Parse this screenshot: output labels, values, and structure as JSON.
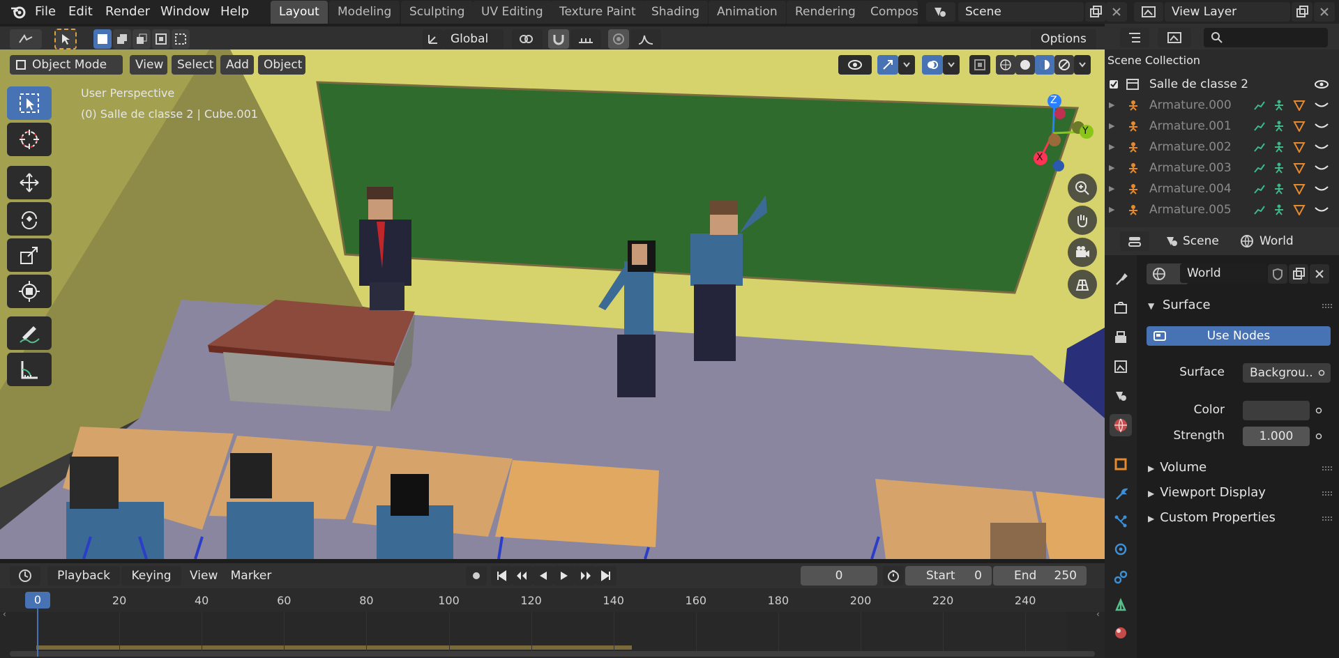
{
  "topbar": {
    "menus": [
      "File",
      "Edit",
      "Render",
      "Window",
      "Help"
    ],
    "workspaces": [
      "Layout",
      "Modeling",
      "Sculpting",
      "UV Editing",
      "Texture Paint",
      "Shading",
      "Animation",
      "Rendering",
      "Compos"
    ],
    "scene_name": "Scene",
    "view_layer": "View Layer"
  },
  "viewport_header": {
    "orientation": "Global",
    "options": "Options",
    "mode": "Object Mode",
    "menus": [
      "View",
      "Select",
      "Add",
      "Object"
    ]
  },
  "viewport": {
    "perspective": "User Perspective",
    "context": "(0) Salle de classe 2 | Cube.001",
    "gizmo": {
      "z": "Z",
      "y": "Y",
      "x": "X"
    }
  },
  "outliner": {
    "title": "Scene Collection",
    "collection": "Salle de classe 2",
    "items": [
      "Armature.000",
      "Armature.001",
      "Armature.002",
      "Armature.003",
      "Armature.004",
      "Armature.005"
    ]
  },
  "properties": {
    "tabs_label_scene": "Scene",
    "tabs_label_world": "World",
    "world_name": "World",
    "surface_section": "Surface",
    "use_nodes": "Use Nodes",
    "surface_label": "Surface",
    "surface_value": "Backgrou..",
    "color_label": "Color",
    "strength_label": "Strength",
    "strength_value": "1.000",
    "collapsed_sections": [
      "Volume",
      "Viewport Display",
      "Custom Properties"
    ]
  },
  "timeline": {
    "menus": [
      "Playback",
      "Keying",
      "View",
      "Marker"
    ],
    "current_frame": "0",
    "start_label": "Start",
    "start_value": "0",
    "end_label": "End",
    "end_value": "250",
    "ruler": [
      "0",
      "20",
      "40",
      "60",
      "80",
      "100",
      "120",
      "140",
      "160",
      "180",
      "200",
      "220",
      "240"
    ]
  },
  "colors": {
    "accent": "#4772b3",
    "wall": "#d6d36c",
    "floor": "#8a86a0",
    "board": "#2e6b2c",
    "desk_top": "#d6a46a"
  }
}
